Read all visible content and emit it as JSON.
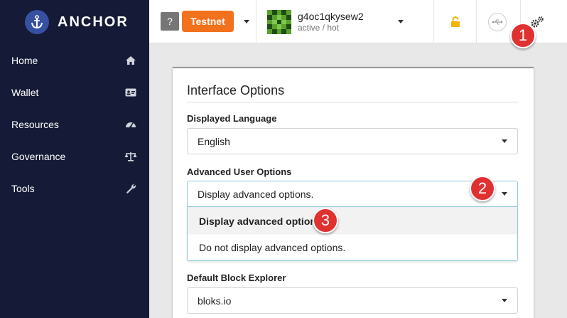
{
  "app": {
    "brand": "ANCHOR"
  },
  "sidebar": {
    "items": [
      {
        "label": "Home",
        "icon": "home-icon"
      },
      {
        "label": "Wallet",
        "icon": "id-card-icon"
      },
      {
        "label": "Resources",
        "icon": "gauge-icon"
      },
      {
        "label": "Governance",
        "icon": "balance-scale-icon"
      },
      {
        "label": "Tools",
        "icon": "wrench-icon"
      }
    ]
  },
  "topbar": {
    "chain_help": "?",
    "chain_name": "Testnet",
    "account_name": "g4oc1qkysew2",
    "account_permission": "active / hot",
    "icons": [
      "unlock-icon",
      "usb-icon",
      "settings-gears-icon"
    ]
  },
  "settings": {
    "title": "Interface Options",
    "language": {
      "label": "Displayed Language",
      "value": "English"
    },
    "advanced": {
      "label": "Advanced User Options",
      "value": "Display advanced options.",
      "options": [
        "Display advanced options.",
        "Do not display advanced options."
      ]
    },
    "explorer": {
      "label": "Default Block Explorer",
      "value": "bloks.io"
    }
  },
  "callouts": [
    "1",
    "2",
    "3"
  ],
  "colors": {
    "sidebar_bg": "#151b36",
    "brand_blue": "#3650a2",
    "testnet_orange": "#f2711c",
    "unlock_yellow": "#f5b400",
    "callout_red": "#e03131"
  }
}
